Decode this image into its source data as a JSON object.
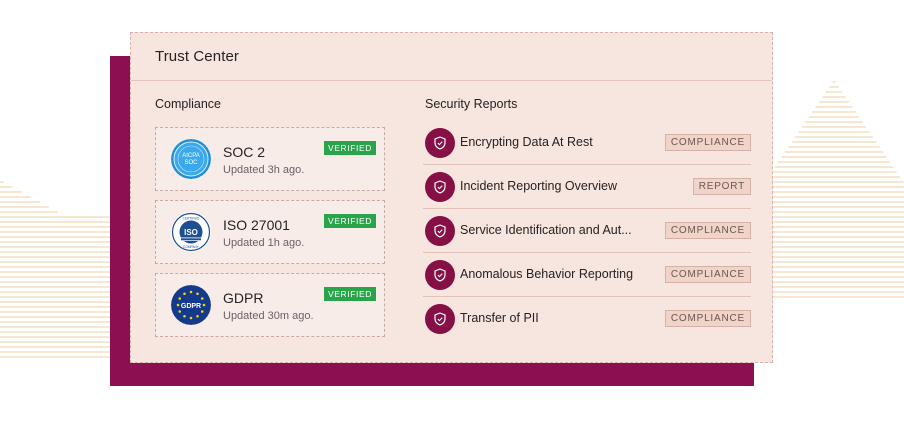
{
  "colors": {
    "page_background": "#ffffff",
    "backing": "#8c0f52",
    "card_background": "#f7e5df",
    "verified_badge": "#2aa44a",
    "shield_circle": "#861045",
    "stripes": "#f2cfa0"
  },
  "header": {
    "title": "Trust Center"
  },
  "compliance": {
    "title": "Compliance",
    "items": [
      {
        "name": "SOC 2",
        "updated": "Updated 3h ago.",
        "badge": "VERIFIED",
        "logo": "aicpa-soc-logo"
      },
      {
        "name": "ISO 27001",
        "updated": "Updated 1h ago.",
        "badge": "VERIFIED",
        "logo": "iso-certified-logo"
      },
      {
        "name": "GDPR",
        "updated": "Updated 30m ago.",
        "badge": "VERIFIED",
        "logo": "gdpr-logo"
      }
    ]
  },
  "reports": {
    "title": "Security Reports",
    "items": [
      {
        "name": "Encrypting Data At Rest",
        "tag": "COMPLIANCE",
        "icon": "shield-check-icon"
      },
      {
        "name": "Incident Reporting Overview",
        "tag": "REPORT",
        "icon": "shield-check-icon"
      },
      {
        "name": "Service Identification and Aut...",
        "tag": "COMPLIANCE",
        "icon": "shield-check-icon"
      },
      {
        "name": "Anomalous Behavior Reporting",
        "tag": "COMPLIANCE",
        "icon": "shield-check-icon"
      },
      {
        "name": "Transfer of PII",
        "tag": "COMPLIANCE",
        "icon": "shield-check-icon"
      }
    ]
  }
}
